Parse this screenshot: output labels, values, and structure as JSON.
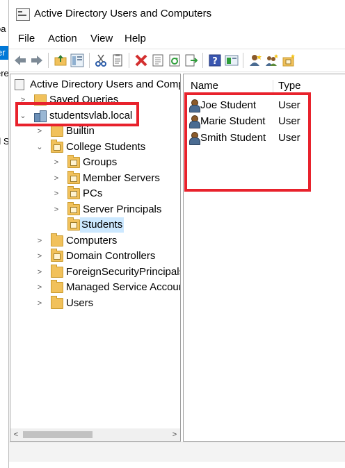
{
  "window": {
    "title": "Active Directory Users and Computers"
  },
  "menu": [
    "File",
    "Action",
    "View",
    "Help"
  ],
  "toolbar_icons": [
    "back-arrow-icon",
    "forward-arrow-icon",
    "up-folder-icon",
    "console-tree-icon",
    "cut-icon",
    "copy-icon",
    "delete-icon",
    "properties-icon",
    "refresh-icon",
    "export-icon",
    "help-icon",
    "show-pane-icon",
    "new-user-icon",
    "new-group-icon",
    "new-ou-icon"
  ],
  "tree": {
    "root": "Active Directory Users and Comp",
    "saved_queries": "Saved Queries",
    "domain": "studentsvlab.local",
    "builtin": "Builtin",
    "college_students": "College Students",
    "groups": "Groups",
    "member_servers": "Member Servers",
    "pcs": "PCs",
    "server_principals": "Server Principals",
    "students": "Students",
    "computers": "Computers",
    "domain_controllers": "Domain Controllers",
    "foreign_security_principals": "ForeignSecurityPrincipals",
    "managed_service_accounts": "Managed Service Accoun",
    "users": "Users"
  },
  "list": {
    "headers": {
      "name": "Name",
      "type": "Type"
    },
    "rows": [
      {
        "name": "Joe Student",
        "type": "User"
      },
      {
        "name": "Marie Student",
        "type": "User"
      },
      {
        "name": "Smith Student",
        "type": "User"
      }
    ]
  },
  "background_fragments": [
    "oa",
    "er",
    "ere",
    "d S"
  ],
  "colors": {
    "highlight_red": "#e8222c",
    "selection": "#cce8ff",
    "folder": "#f1c15b"
  }
}
